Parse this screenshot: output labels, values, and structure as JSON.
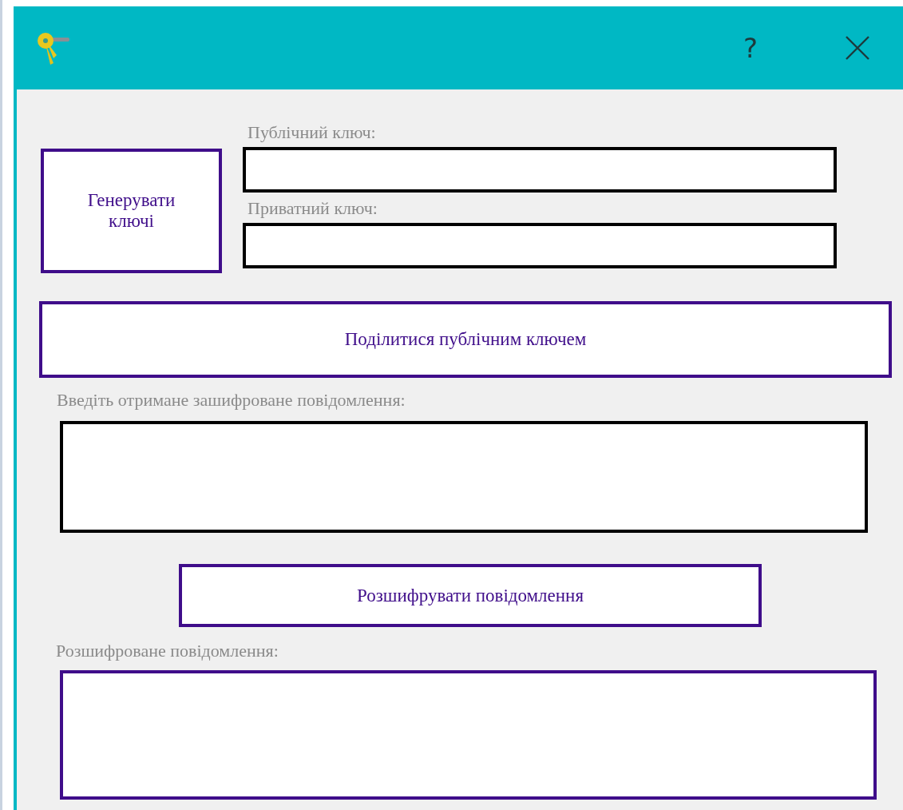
{
  "window": {
    "help": "?"
  },
  "generate_button": {
    "label": "Генерувати ключі"
  },
  "public_key": {
    "label": "Публічний ключ:"
  },
  "private_key": {
    "label": "Приватний ключ:"
  },
  "share_button": {
    "label": "Поділитися публічним ключем"
  },
  "encrypted_message": {
    "label": "Введіть отримане зашифроване повідомлення:"
  },
  "decrypt_button": {
    "label": "Розшифрувати повідомлення"
  },
  "decrypted_message": {
    "label": "Розшифроване повідомлення:"
  }
}
